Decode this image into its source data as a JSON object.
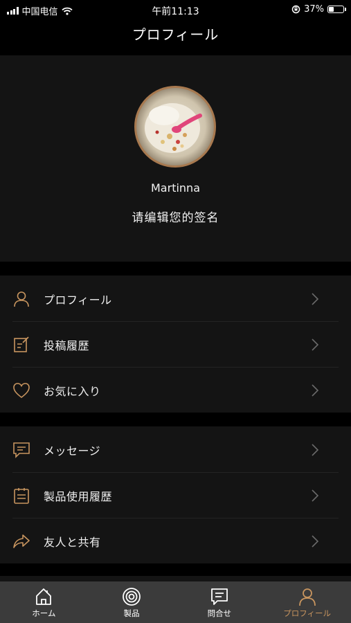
{
  "status_bar": {
    "carrier": "中国电信",
    "time": "午前11:13",
    "battery_percent": "37%",
    "battery_level": 0.37
  },
  "header": {
    "title": "プロフィール"
  },
  "profile": {
    "username": "Martinna",
    "signature": "请编辑您的签名"
  },
  "menu_group_1": [
    {
      "label": "プロフィール",
      "icon": "person-icon"
    },
    {
      "label": "投稿履歴",
      "icon": "edit-note-icon"
    },
    {
      "label": "お気に入り",
      "icon": "heart-icon"
    }
  ],
  "menu_group_2": [
    {
      "label": "メッセージ",
      "icon": "message-icon"
    },
    {
      "label": "製品使用履歴",
      "icon": "clipboard-icon"
    },
    {
      "label": "友人と共有",
      "icon": "share-arrow-icon"
    }
  ],
  "tab_bar": [
    {
      "label": "ホーム",
      "icon": "home-icon",
      "active": false
    },
    {
      "label": "製品",
      "icon": "product-disc-icon",
      "active": false
    },
    {
      "label": "問合せ",
      "icon": "inquiry-icon",
      "active": false
    },
    {
      "label": "プロフィール",
      "icon": "profile-icon",
      "active": true
    }
  ],
  "colors": {
    "accent": "#c8955f",
    "background": "#000000",
    "card": "#141414",
    "tab_bar": "#3b3b3b"
  }
}
